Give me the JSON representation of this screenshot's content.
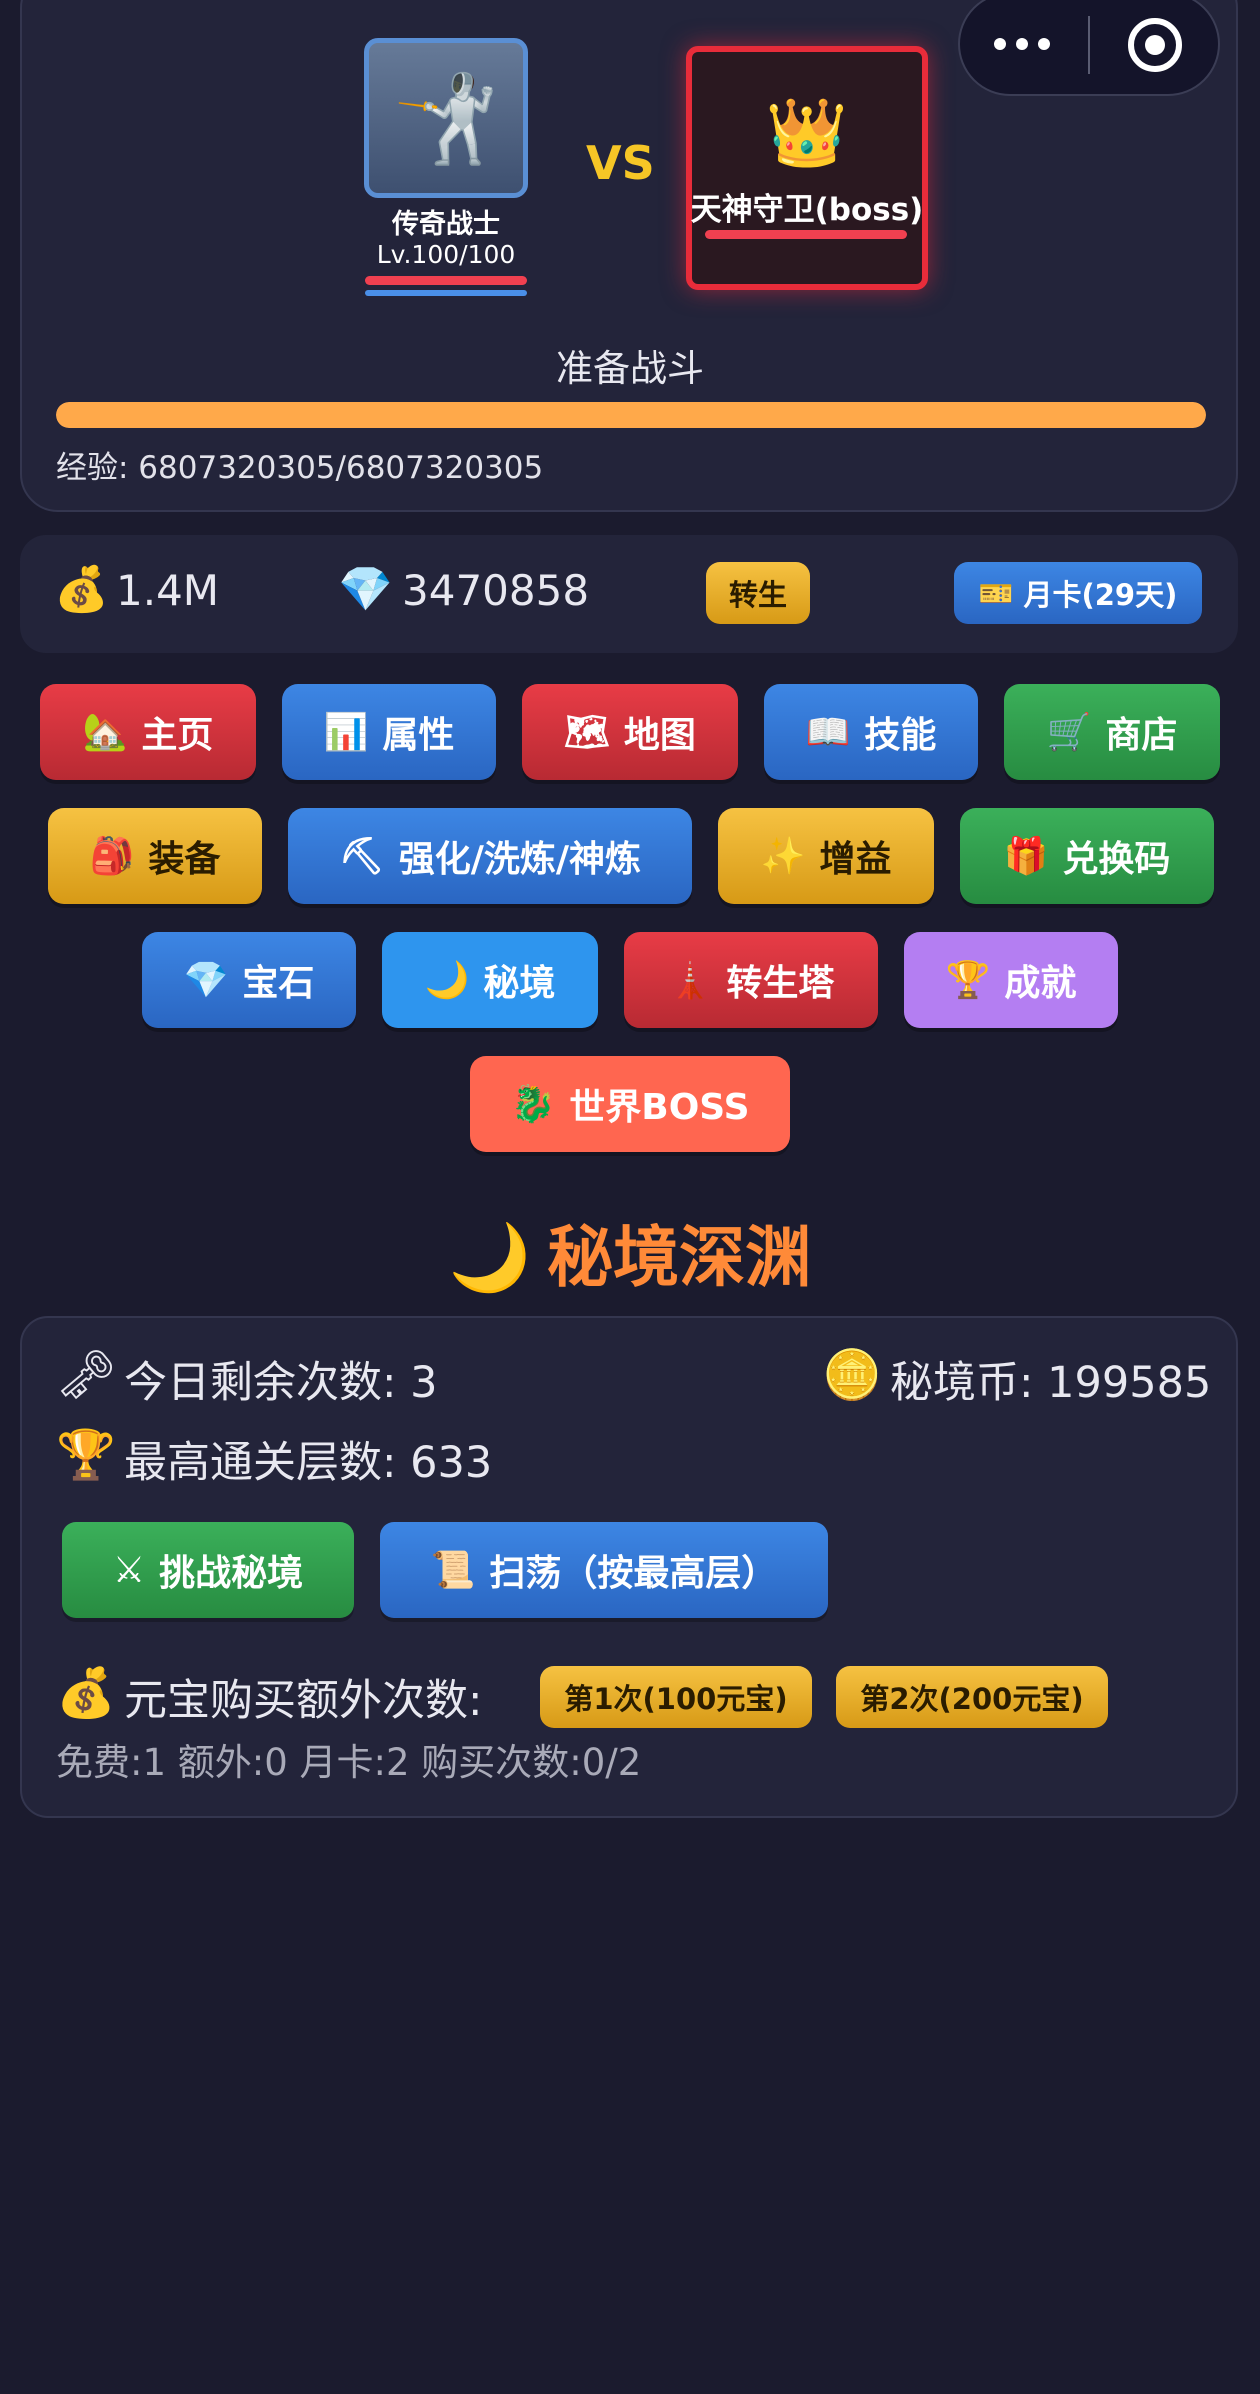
{
  "battle": {
    "player": {
      "name": "传奇战士",
      "level": "Lv.100/100",
      "avatar_icon": "fencer-icon"
    },
    "vs": "VS",
    "boss": {
      "name": "天神守卫(boss)",
      "icon": "crown-icon"
    },
    "status": "准备战斗",
    "exp_text": "经验: 6807320305/6807320305",
    "exp_progress": 1.0
  },
  "resources": {
    "gold": "1.4M",
    "diamonds": "3470858",
    "rebirth_label": "转生",
    "monthly_card_label": "月卡(29天)"
  },
  "nav": {
    "row1": [
      {
        "icon": "🏡",
        "label": "主页"
      },
      {
        "icon": "📊",
        "label": "属性"
      },
      {
        "icon": "🗺",
        "label": "地图"
      },
      {
        "icon": "📖",
        "label": "技能"
      },
      {
        "icon": "🛒",
        "label": "商店"
      }
    ],
    "row2": [
      {
        "icon": "🎒",
        "label": "装备"
      },
      {
        "icon": "⛏",
        "label": "强化/洗炼/神炼"
      },
      {
        "icon": "✨",
        "label": "增益"
      },
      {
        "icon": "🎁",
        "label": "兑换码"
      }
    ],
    "row3": [
      {
        "icon": "💎",
        "label": "宝石"
      },
      {
        "icon": "🌙",
        "label": "秘境"
      },
      {
        "icon": "🗼",
        "label": "转生塔"
      },
      {
        "icon": "🏆",
        "label": "成就"
      }
    ],
    "row4": [
      {
        "icon": "🐉",
        "label": "世界BOSS"
      }
    ]
  },
  "realm": {
    "title": "秘境深渊",
    "remaining_today": "今日剩余次数: 3",
    "realm_coins": "秘境币: 199585",
    "highest_floor": "最高通关层数: 633",
    "challenge_label": "挑战秘境",
    "sweep_label": "扫荡（按最高层）",
    "buy_label": "元宝购买额外次数:",
    "buy_options": [
      "第1次(100元宝)",
      "第2次(200元宝)"
    ],
    "quota_text": "免费:1 额外:0 月卡:2 购买次数:0/2"
  },
  "colors": {
    "background": "#1b1b2e",
    "panel": "#23243a",
    "accent_orange": "#ff8a38",
    "vs_yellow": "#f6c626",
    "boss_red": "#e82c3a",
    "exp_orange": "#ffa94a"
  }
}
